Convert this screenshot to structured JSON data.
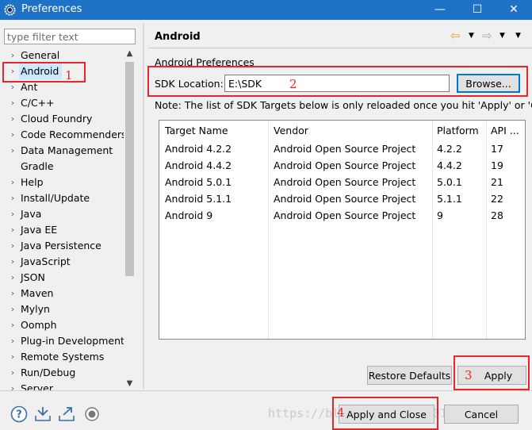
{
  "window": {
    "title": "Preferences",
    "minimize_glyph": "—",
    "maximize_glyph": "☐",
    "close_glyph": "✕"
  },
  "sidebar": {
    "filter_placeholder": "type filter text",
    "items": [
      {
        "label": "General",
        "expandable": true
      },
      {
        "label": "Android",
        "expandable": true,
        "selected": true
      },
      {
        "label": "Ant",
        "expandable": true
      },
      {
        "label": "C/C++",
        "expandable": true
      },
      {
        "label": "Cloud Foundry",
        "expandable": true
      },
      {
        "label": "Code Recommenders",
        "expandable": true
      },
      {
        "label": "Data Management",
        "expandable": true
      },
      {
        "label": "Gradle",
        "expandable": false
      },
      {
        "label": "Help",
        "expandable": true
      },
      {
        "label": "Install/Update",
        "expandable": true
      },
      {
        "label": "Java",
        "expandable": true
      },
      {
        "label": "Java EE",
        "expandable": true
      },
      {
        "label": "Java Persistence",
        "expandable": true
      },
      {
        "label": "JavaScript",
        "expandable": true
      },
      {
        "label": "JSON",
        "expandable": true
      },
      {
        "label": "Maven",
        "expandable": true
      },
      {
        "label": "Mylyn",
        "expandable": true
      },
      {
        "label": "Oomph",
        "expandable": true
      },
      {
        "label": "Plug-in Development",
        "expandable": true
      },
      {
        "label": "Remote Systems",
        "expandable": true
      },
      {
        "label": "Run/Debug",
        "expandable": true
      },
      {
        "label": "Server",
        "expandable": true
      }
    ]
  },
  "page": {
    "title": "Android",
    "section": "Android Preferences",
    "sdk_label": "SDK Location:",
    "sdk_value": "E:\\SDK",
    "browse_label": "Browse...",
    "note": "Note: The list of SDK Targets below is only reloaded once you hit 'Apply' or 'OK'.",
    "table": {
      "columns": [
        "Target Name",
        "Vendor",
        "Platform",
        "API ..."
      ],
      "rows": [
        [
          "Android 4.2.2",
          "Android Open Source Project",
          "4.2.2",
          "17"
        ],
        [
          "Android 4.4.2",
          "Android Open Source Project",
          "4.4.2",
          "19"
        ],
        [
          "Android 5.0.1",
          "Android Open Source Project",
          "5.0.1",
          "21"
        ],
        [
          "Android 5.1.1",
          "Android Open Source Project",
          "5.1.1",
          "22"
        ],
        [
          "Android 9",
          "Android Open Source Project",
          "9",
          "28"
        ]
      ]
    },
    "restore_defaults_label": "Restore Defaults",
    "apply_label": "Apply"
  },
  "footer": {
    "apply_close_label": "Apply and Close",
    "cancel_label": "Cancel"
  },
  "annotations": [
    "1",
    "2",
    "3",
    "4"
  ],
  "watermark": "https://blog.csdn.net/u010142510",
  "colors": {
    "titlebar": "#1e72c6",
    "selection": "#cce8ff",
    "annotation": "#e8262a",
    "focus": "#0078d7"
  }
}
